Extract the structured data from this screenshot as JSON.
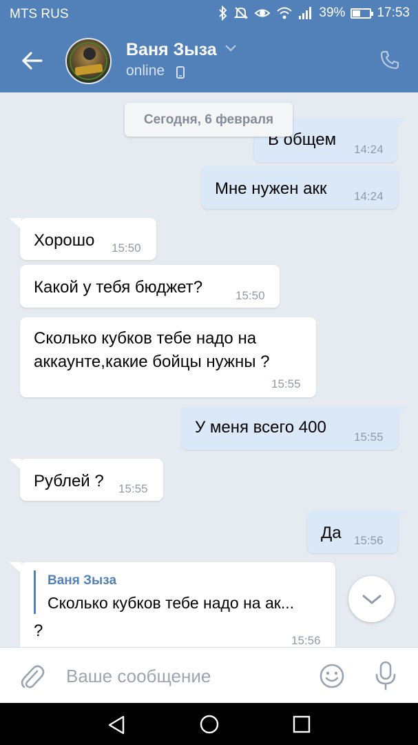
{
  "status_bar": {
    "carrier": "MTS RUS",
    "battery": "39%",
    "battery_level": 0.39,
    "time": "17:53"
  },
  "header": {
    "contact_name": "Ваня Зыза",
    "contact_status": "online"
  },
  "chat": {
    "date_separator": "Сегодня, 6 февраля",
    "messages": [
      {
        "dir": "out",
        "text": "В общем",
        "time": "14:24"
      },
      {
        "dir": "out",
        "text": "Мне нужен акк",
        "time": "14:24"
      },
      {
        "dir": "in",
        "text": "Хорошо",
        "time": "15:50"
      },
      {
        "dir": "in",
        "text": "Какой у тебя бюджет?",
        "time": "15:50"
      },
      {
        "dir": "in",
        "text_line1": "Сколько кубков тебе надо на",
        "text_line2": "аккаунте,какие бойцы нужны ?",
        "time": "15:55"
      },
      {
        "dir": "out",
        "text": "У меня всего 400",
        "time": "15:55"
      },
      {
        "dir": "in",
        "text": "Рублей ?",
        "time": "15:55"
      },
      {
        "dir": "out",
        "text": "Да",
        "time": "15:56"
      },
      {
        "dir": "in",
        "reply_name": "Ваня Зыза",
        "reply_text": "Сколько кубков тебе надо на ак...",
        "text": "?",
        "time": "15:56"
      }
    ]
  },
  "composer": {
    "placeholder": "Ваше сообщение"
  },
  "colors": {
    "header": "#5181b8",
    "background": "#e6ebf1",
    "outgoing_bubble": "#dbe8f8",
    "incoming_bubble": "#ffffff",
    "accent": "#5181b8"
  },
  "icons": [
    "back-arrow-icon",
    "chevron-down-icon",
    "mobile-icon",
    "phone-icon",
    "attach-icon",
    "emoji-icon",
    "mic-icon",
    "scroll-down-icon",
    "nav-back-icon",
    "nav-home-icon",
    "nav-recent-icon"
  ]
}
